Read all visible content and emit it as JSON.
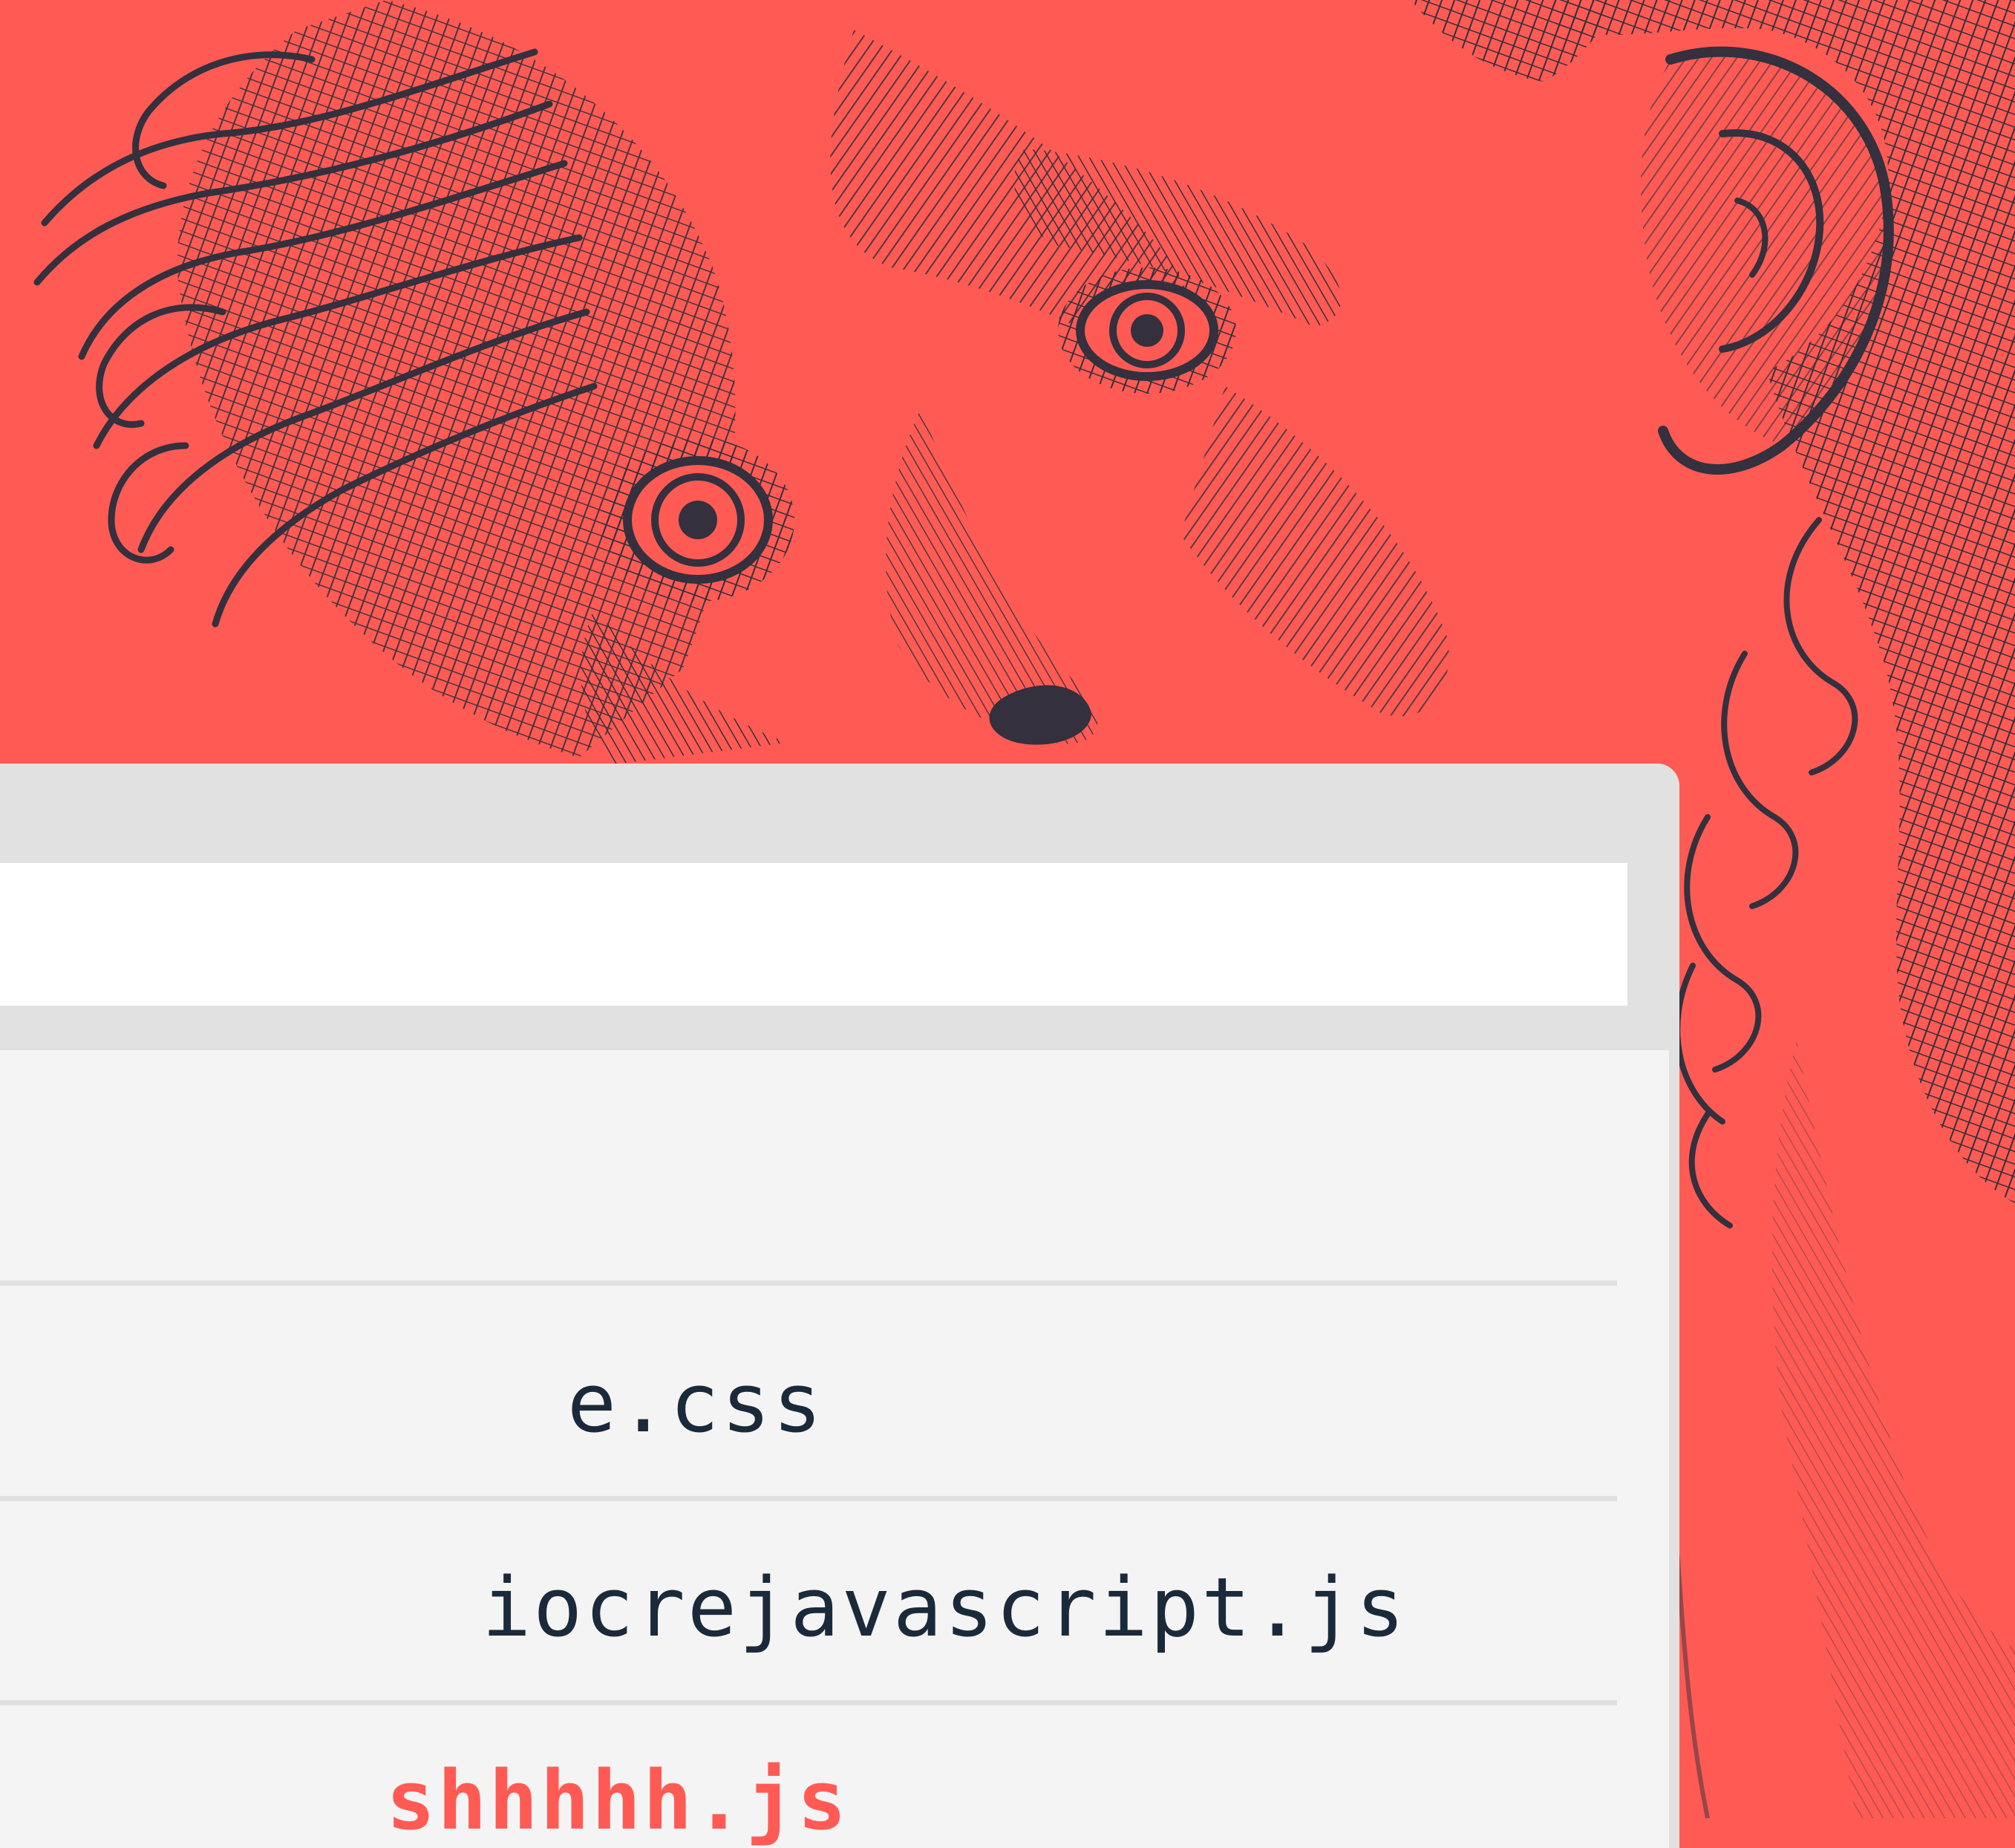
{
  "colors": {
    "background": "#ff5b54",
    "engraving_ink": "#34303d",
    "window_chrome": "#e1e1e1",
    "address_bar": "#ffffff",
    "file_list": "#f4f4f4",
    "file_text": "#1b2a3a",
    "highlight_text": "#ff5b54"
  },
  "illustration": {
    "subject": "engraved-face-icon"
  },
  "files": [
    {
      "name": "e.css",
      "highlighted": false
    },
    {
      "name": "iocrejavascript.js",
      "highlighted": false
    },
    {
      "name": "shhhhh.js",
      "highlighted": true
    }
  ]
}
